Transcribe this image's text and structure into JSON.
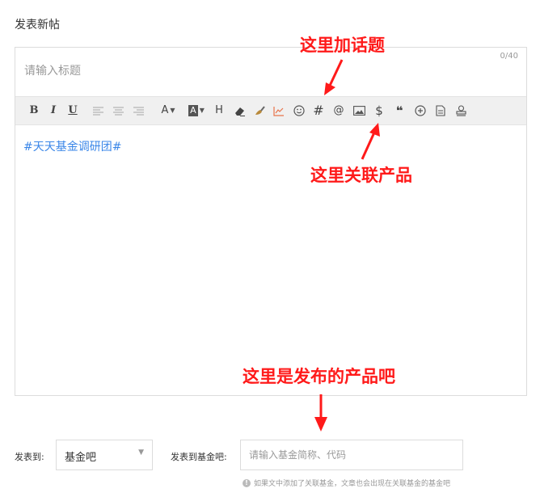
{
  "page": {
    "title": "发表新帖"
  },
  "editor": {
    "title_placeholder": "请输入标题",
    "title_count": "0/40",
    "content_topic": "#天天基金调研团#"
  },
  "toolbar": {
    "bold": "B",
    "italic": "I",
    "underline": "U",
    "font_color": "A",
    "bg_color": "A",
    "heading": "H",
    "topic": "#",
    "mention": "@",
    "product": "$",
    "quote": "❝"
  },
  "annotations": {
    "topic_hint": "这里加话题",
    "product_hint": "这里关联产品",
    "publish_hint": "这里是发布的产品吧"
  },
  "publish": {
    "to_label": "发表到:",
    "selected": "基金吧",
    "fund_label": "发表到基金吧:",
    "fund_placeholder": "请输入基金简称、代码",
    "hint": "如果文中添加了关联基金，文章也会出现在关联基金的基金吧"
  },
  "colors": {
    "annotation": "#ff1a1a",
    "topic_link": "#3a86e8",
    "toolbar_bg": "#f0f0f0",
    "chart_icon": "#e8734a"
  }
}
